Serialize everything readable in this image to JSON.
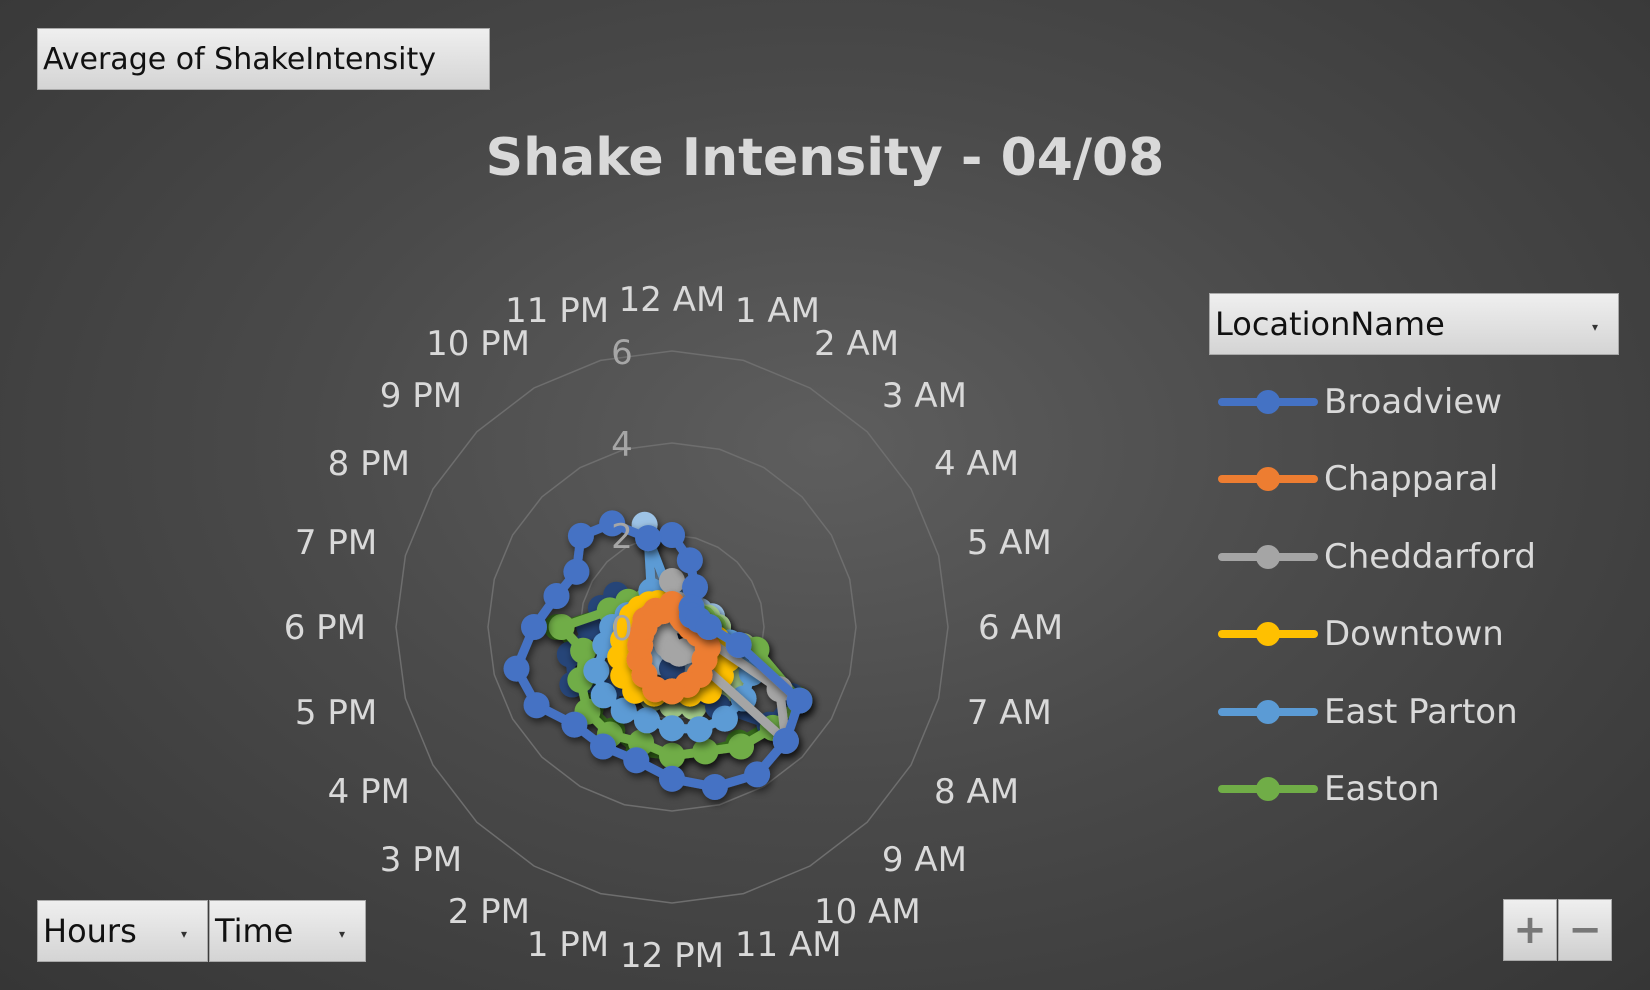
{
  "pivot": {
    "value_field": "Average  of ShakeIntensity",
    "axis_fields": [
      "Hours",
      "Time"
    ],
    "legend_field": "LocationName"
  },
  "zoom": {
    "in_label": "+",
    "out_label": "−"
  },
  "chart_data": {
    "type": "radar",
    "title": "Shake Intensity - 04/08",
    "categories": [
      "12 AM",
      "1 AM",
      "2 AM",
      "3 AM",
      "4 AM",
      "5 AM",
      "6 AM",
      "7 AM",
      "8 AM",
      "9 AM",
      "10 AM",
      "11 AM",
      "12 PM",
      "1 PM",
      "2 PM",
      "3 PM",
      "4 PM",
      "5 PM",
      "6 PM",
      "7 PM",
      "8 PM",
      "9 PM",
      "10 PM",
      "11 PM"
    ],
    "radial_ticks": [
      0,
      2,
      4,
      6
    ],
    "radial_range": [
      0,
      6
    ],
    "grid": true,
    "legend_position": "right",
    "series": [
      {
        "name": "Broadview",
        "color": "#4472c4",
        "values": [
          2.0,
          1.5,
          1.0,
          0.6,
          0.5,
          0.6,
          0.8,
          1.5,
          3.2,
          3.5,
          3.7,
          3.6,
          3.3,
          3.0,
          3.0,
          3.0,
          3.4,
          3.5,
          3.0,
          2.6,
          2.4,
          2.8,
          2.6,
          2.0
        ]
      },
      {
        "name": "Chapparal",
        "color": "#ed7d31",
        "values": [
          0.5,
          0.4,
          0.4,
          0.3,
          0.3,
          0.4,
          0.4,
          0.6,
          0.9,
          1.0,
          1.2,
          1.3,
          1.4,
          1.4,
          1.2,
          1.0,
          0.8,
          0.7,
          0.6,
          0.6,
          0.5,
          0.5,
          0.4,
          0.4
        ]
      },
      {
        "name": "Cheddarford",
        "color": "#a5a5a5",
        "values": [
          1.0,
          0.5,
          0.3,
          0.2,
          0.3,
          0.4,
          0.5,
          0.6,
          2.7,
          3.5,
          0.6,
          0.6,
          0.5,
          0.4,
          0.3,
          0.3,
          0.3,
          0.2,
          0.2,
          0.2,
          0.2,
          0.2,
          0.2,
          0.3
        ]
      },
      {
        "name": "Downtown",
        "color": "#ffc000",
        "values": [
          0.4,
          0.3,
          0.3,
          0.3,
          0.4,
          0.5,
          0.7,
          1.0,
          1.4,
          1.5,
          1.6,
          1.5,
          1.4,
          1.5,
          1.6,
          1.5,
          1.3,
          1.1,
          1.0,
          0.9,
          0.8,
          0.7,
          0.6,
          0.5
        ]
      },
      {
        "name": "East Parton",
        "color": "#5b9bd5",
        "values": [
          0.6,
          0.5,
          0.4,
          0.3,
          0.4,
          0.5,
          0.8,
          1.3,
          2.0,
          2.2,
          2.3,
          2.3,
          2.2,
          2.1,
          2.1,
          2.1,
          1.9,
          1.5,
          1.3,
          1.0,
          0.6,
          0.4,
          0.9,
          2.0
        ]
      },
      {
        "name": "Easton",
        "color": "#70ad47",
        "values": [
          0.3,
          0.2,
          0.3,
          0.4,
          0.5,
          0.7,
          0.9,
          1.9,
          3.2,
          3.1,
          3.0,
          2.8,
          2.8,
          2.6,
          2.7,
          2.6,
          2.3,
          2.0,
          2.4,
          1.4,
          1.1,
          0.8,
          0.5,
          0.3
        ]
      },
      {
        "name": "",
        "color": "#264478",
        "values": [
          0.0,
          0.0,
          0.2,
          0.3,
          0.2,
          0.3,
          0.6,
          1.5,
          3.0,
          3.0,
          2.0,
          1.5,
          0.9,
          1.5,
          1.6,
          2.0,
          2.5,
          2.3,
          1.8,
          1.6,
          1.4,
          0.6,
          0.4,
          0.1
        ]
      },
      {
        "name": "",
        "color": "#a9d18e",
        "values": [
          0.3,
          0.2,
          0.3,
          0.4,
          0.6,
          0.8,
          1.0,
          1.6,
          1.8,
          1.9,
          1.9,
          1.8,
          1.7,
          1.6,
          1.5,
          1.4,
          1.2,
          1.0,
          0.8,
          0.6,
          0.5,
          0.4,
          0.3,
          0.3
        ]
      },
      {
        "name": "",
        "color": "#9dc3e6",
        "values": [
          0.2,
          0.3,
          0.4,
          0.5,
          0.7,
          0.9,
          1.0,
          1.1,
          1.2,
          1.2,
          1.1,
          1.0,
          0.9,
          0.8,
          0.7,
          0.6,
          0.5,
          0.4,
          0.3,
          0.2,
          0.2,
          0.3,
          0.5,
          2.3
        ]
      },
      {
        "name": "",
        "color": "#38701e",
        "values": [
          0.3,
          0.2,
          0.3,
          0.4,
          0.6,
          0.8,
          0.9,
          1.9,
          3.1,
          3.0,
          2.9,
          2.8,
          2.8,
          2.8,
          2.6,
          2.5,
          2.2,
          2.1,
          2.5,
          1.4,
          1.1,
          0.8,
          0.5,
          0.3
        ]
      }
    ]
  }
}
